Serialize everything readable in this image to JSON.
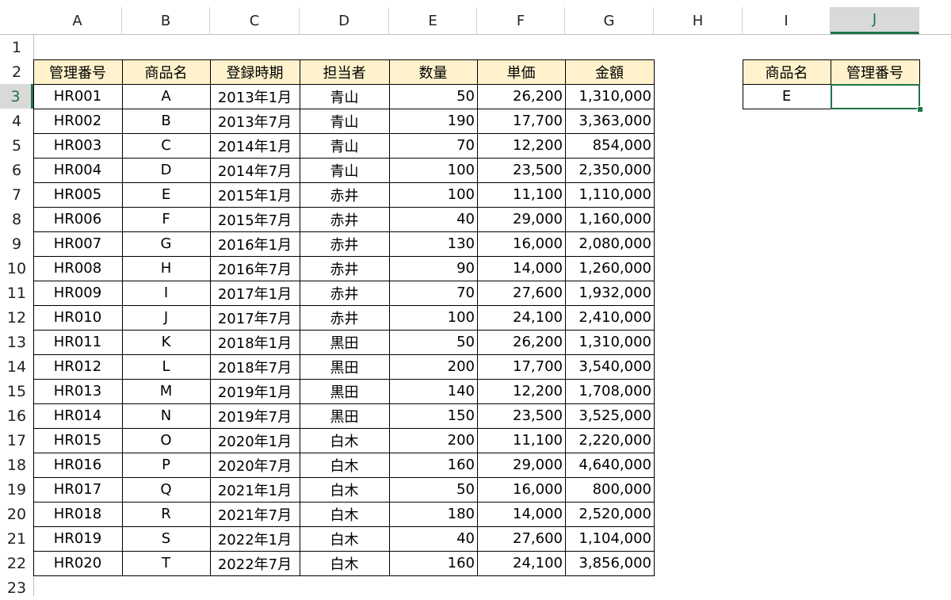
{
  "columns": [
    "A",
    "B",
    "C",
    "D",
    "E",
    "F",
    "G",
    "H",
    "I",
    "J"
  ],
  "rows": [
    "1",
    "2",
    "3",
    "4",
    "5",
    "6",
    "7",
    "8",
    "9",
    "10",
    "11",
    "12",
    "13",
    "14",
    "15",
    "16",
    "17",
    "18",
    "19",
    "20",
    "21",
    "22",
    "23"
  ],
  "selected_column": "J",
  "selected_row": "3",
  "main_table": {
    "headers": [
      "管理番号",
      "商品名",
      "登録時期",
      "担当者",
      "数量",
      "単価",
      "金額"
    ],
    "rows": [
      [
        "HR001",
        "A",
        "2013年1月",
        "青山",
        "50",
        "26,200",
        "1,310,000"
      ],
      [
        "HR002",
        "B",
        "2013年7月",
        "青山",
        "190",
        "17,700",
        "3,363,000"
      ],
      [
        "HR003",
        "C",
        "2014年1月",
        "青山",
        "70",
        "12,200",
        "854,000"
      ],
      [
        "HR004",
        "D",
        "2014年7月",
        "青山",
        "100",
        "23,500",
        "2,350,000"
      ],
      [
        "HR005",
        "E",
        "2015年1月",
        "赤井",
        "100",
        "11,100",
        "1,110,000"
      ],
      [
        "HR006",
        "F",
        "2015年7月",
        "赤井",
        "40",
        "29,000",
        "1,160,000"
      ],
      [
        "HR007",
        "G",
        "2016年1月",
        "赤井",
        "130",
        "16,000",
        "2,080,000"
      ],
      [
        "HR008",
        "H",
        "2016年7月",
        "赤井",
        "90",
        "14,000",
        "1,260,000"
      ],
      [
        "HR009",
        "I",
        "2017年1月",
        "赤井",
        "70",
        "27,600",
        "1,932,000"
      ],
      [
        "HR010",
        "J",
        "2017年7月",
        "赤井",
        "100",
        "24,100",
        "2,410,000"
      ],
      [
        "HR011",
        "K",
        "2018年1月",
        "黒田",
        "50",
        "26,200",
        "1,310,000"
      ],
      [
        "HR012",
        "L",
        "2018年7月",
        "黒田",
        "200",
        "17,700",
        "3,540,000"
      ],
      [
        "HR013",
        "M",
        "2019年1月",
        "黒田",
        "140",
        "12,200",
        "1,708,000"
      ],
      [
        "HR014",
        "N",
        "2019年7月",
        "黒田",
        "150",
        "23,500",
        "3,525,000"
      ],
      [
        "HR015",
        "O",
        "2020年1月",
        "白木",
        "200",
        "11,100",
        "2,220,000"
      ],
      [
        "HR016",
        "P",
        "2020年7月",
        "白木",
        "160",
        "29,000",
        "4,640,000"
      ],
      [
        "HR017",
        "Q",
        "2021年1月",
        "白木",
        "50",
        "16,000",
        "800,000"
      ],
      [
        "HR018",
        "R",
        "2021年7月",
        "白木",
        "180",
        "14,000",
        "2,520,000"
      ],
      [
        "HR019",
        "S",
        "2022年1月",
        "白木",
        "40",
        "27,600",
        "1,104,000"
      ],
      [
        "HR020",
        "T",
        "2022年7月",
        "白木",
        "160",
        "24,100",
        "3,856,000"
      ]
    ]
  },
  "lookup_table": {
    "headers": [
      "商品名",
      "管理番号"
    ],
    "row": [
      "E",
      ""
    ]
  }
}
